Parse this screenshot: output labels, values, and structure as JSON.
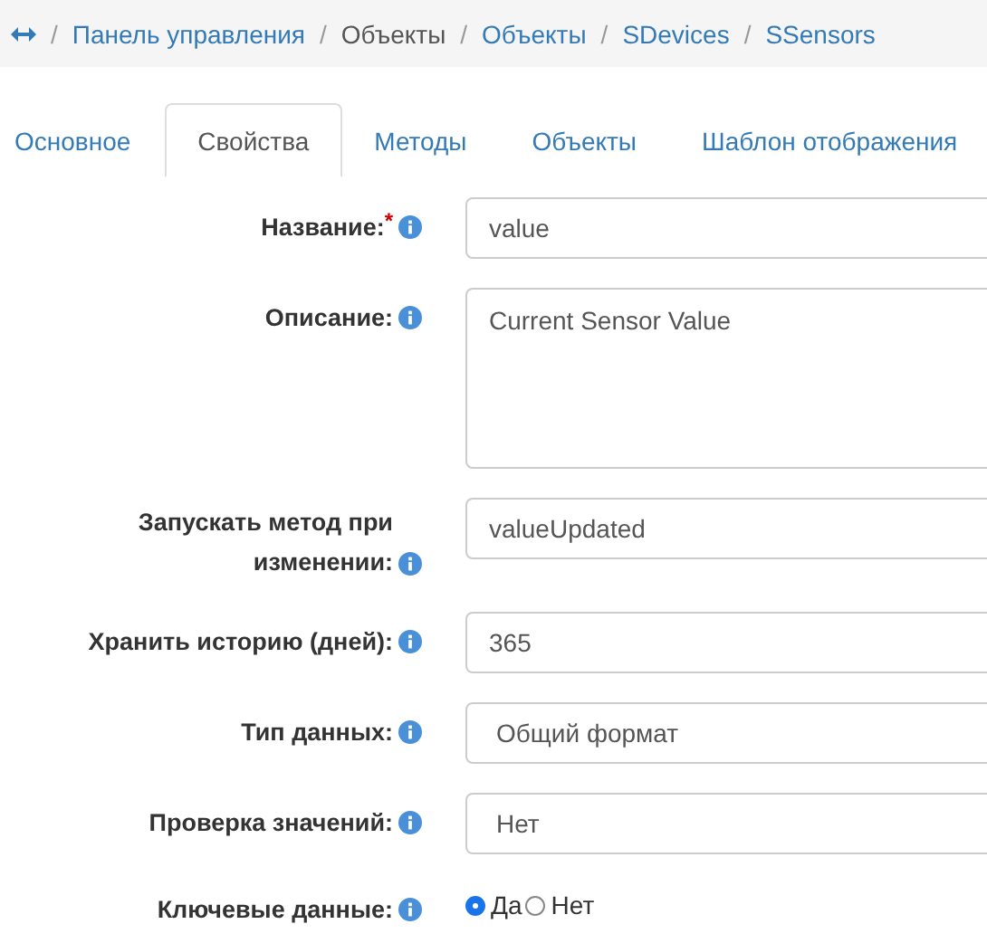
{
  "breadcrumb": [
    {
      "separator": "/",
      "label": "Панель управления",
      "link": true
    },
    {
      "separator": "/",
      "label": "Объекты",
      "link": false
    },
    {
      "separator": "/",
      "label": "Объекты",
      "link": true
    },
    {
      "separator": "/",
      "label": "SDevices",
      "link": true
    },
    {
      "separator": "/",
      "label": "SSensors",
      "link": true
    }
  ],
  "tabs": [
    {
      "label": "Основное",
      "selected": false
    },
    {
      "label": "Свойства",
      "selected": true
    },
    {
      "label": "Методы",
      "selected": false
    },
    {
      "label": "Объекты",
      "selected": false
    },
    {
      "label": "Шаблон отображения",
      "selected": false
    }
  ],
  "fields": [
    {
      "kind": "text",
      "label": "Название:",
      "required_mark": "*",
      "value": "value"
    },
    {
      "kind": "textarea",
      "label": "Описание:",
      "value": "Current Sensor Value"
    },
    {
      "kind": "text",
      "label": "Запускать метод при изменении:",
      "value": "valueUpdated"
    },
    {
      "kind": "text",
      "label": "Хранить историю (дней):",
      "value": "365"
    },
    {
      "kind": "select",
      "label": "Тип данных:",
      "value": "Общий формат"
    },
    {
      "kind": "select",
      "label": "Проверка значений:",
      "value": "Нет"
    },
    {
      "kind": "radio",
      "label": "Ключевые данные:",
      "options": [
        {
          "label": "Да",
          "selected": true
        },
        {
          "label": "Нет",
          "selected": false
        }
      ]
    }
  ]
}
